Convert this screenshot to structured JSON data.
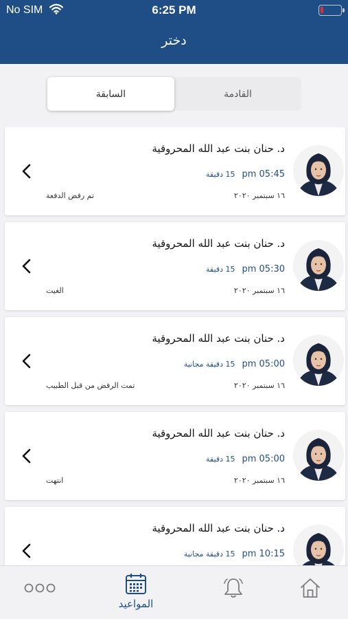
{
  "status_bar": {
    "carrier": "No SIM",
    "time": "6:25 PM",
    "battery_level": 0.15
  },
  "header": {
    "title": "دختر"
  },
  "segments": {
    "upcoming": "القادمة",
    "past": "السابقة",
    "selected": "past"
  },
  "appointments": [
    {
      "doctor": "د. حنان بنت عبد الله المحروقية",
      "time": "05:45",
      "time_suffix": "pm",
      "duration": "15 دقيقة",
      "date": "١٦ سبتمبر ٢٠٢٠",
      "status": "تم رفض الدفعة"
    },
    {
      "doctor": "د. حنان بنت عبد الله المحروقية",
      "time": "05:30",
      "time_suffix": "pm",
      "duration": "15 دقيقة",
      "date": "١٦ سبتمبر ٢٠٢٠",
      "status": "الغيت"
    },
    {
      "doctor": "د. حنان بنت عبد الله المحروقية",
      "time": "05:00",
      "time_suffix": "pm",
      "duration": "15 دقيقة مجانية",
      "date": "١٦ سبتمبر ٢٠٢٠",
      "status": "تمت الرفض من قبل الطبيب"
    },
    {
      "doctor": "د. حنان بنت عبد الله المحروقية",
      "time": "05:00",
      "time_suffix": "pm",
      "duration": "15 دقيقة",
      "date": "١٦ سبتمبر ٢٠٢٠",
      "status": "انتهت"
    },
    {
      "doctor": "د. حنان بنت عبد الله المحروقية",
      "time": "10:15",
      "time_suffix": "pm",
      "duration": "15 دقيقة مجانية",
      "date": "",
      "status": ""
    }
  ],
  "tab_bar": {
    "appointments_label": "المواعيد",
    "active": "appointments"
  },
  "colors": {
    "primary": "#1f4e86",
    "background": "#f2f2f4"
  }
}
